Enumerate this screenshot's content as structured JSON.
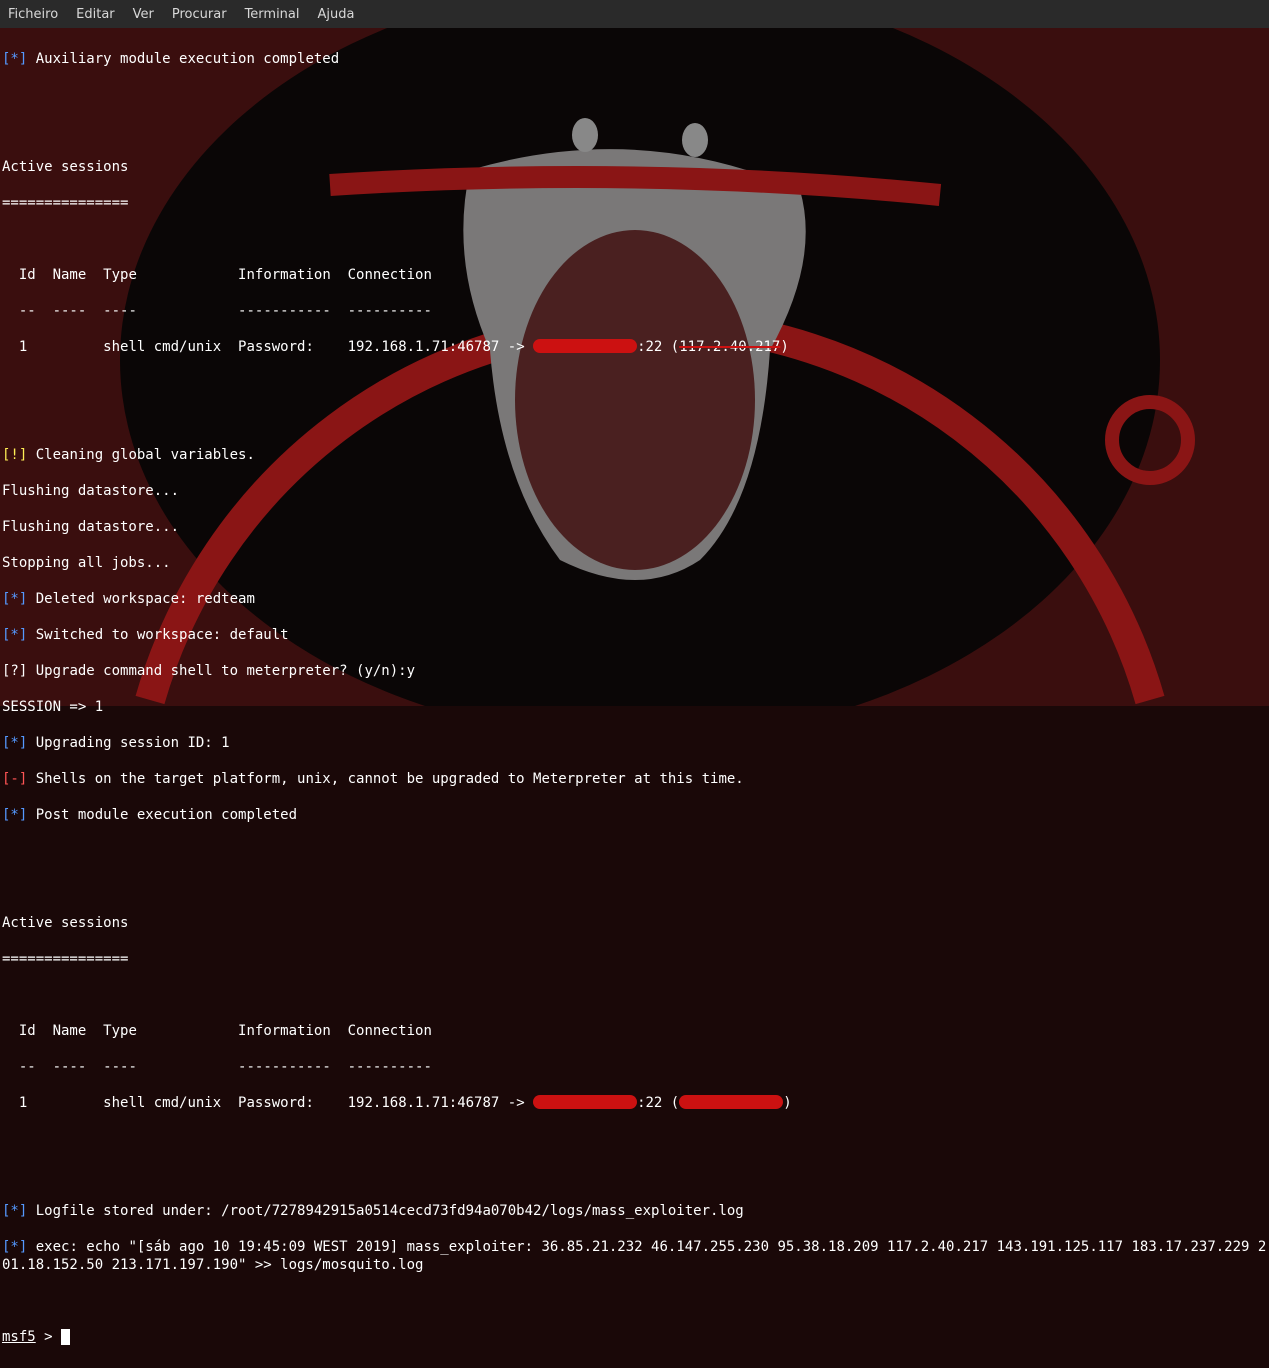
{
  "menu": {
    "items": [
      "Ficheiro",
      "Editar",
      "Ver",
      "Procurar",
      "Terminal",
      "Ajuda"
    ]
  },
  "term": {
    "aux_complete": " Auxiliary module execution completed",
    "active_sessions": "Active sessions",
    "sessions_underline": "===============",
    "hdr_id": "  Id",
    "hdr_name": "Name",
    "hdr_type": "Type",
    "hdr_info": "Information",
    "hdr_conn": "Connection",
    "dash_id": "  --",
    "dash_name": "----",
    "dash_type": "----",
    "dash_info": "-----------",
    "dash_conn": "----------",
    "row1_id": "  1 ",
    "row1_name": "    ",
    "row1_type": "shell cmd/unix",
    "row1_info": "Password: ",
    "row1_conn_a": "192.168.1.71:46787 -> ",
    "row1_conn_b": ":22 (",
    "row1_conn_c": ")",
    "cleaning": " Cleaning global variables.",
    "flush1": "Flushing datastore...",
    "flush2": "Flushing datastore...",
    "stopping": "Stopping all jobs...",
    "del_ws": " Deleted workspace: redteam",
    "sw_ws": " Switched to workspace: default",
    "upgrade_q": " Upgrade command shell to meterpreter? (y/n):y",
    "session_set": "SESSION => 1",
    "upgrading": " Upgrading session ID: 1",
    "shells_err": " Shells on the target platform, unix, cannot be upgraded to Meterpreter at this time.",
    "post_complete": " Post module execution completed",
    "logfile": " Logfile stored under: /root/7278942915a0514cecd73fd94a070b42/logs/mass_exploiter.log",
    "exec_line": " exec: echo \"[sáb ago 10 19:45:09 WEST 2019] mass_exploiter: 36.85.21.232 46.147.255.230 95.38.18.209 117.2.40.217 143.191.125.117 183.17.237.229 201.18.152.50 213.171.197.190\" >> logs/mosquito.log",
    "prompt": "msf5",
    "prompt_gt": " > ",
    "tag_star": "[*]",
    "tag_bang": "[!]",
    "tag_q": "[?]",
    "tag_minus": "[-]",
    "redacted_ip1": "117.2.40.217",
    "redacted_ip2": "117.2.40.217"
  }
}
